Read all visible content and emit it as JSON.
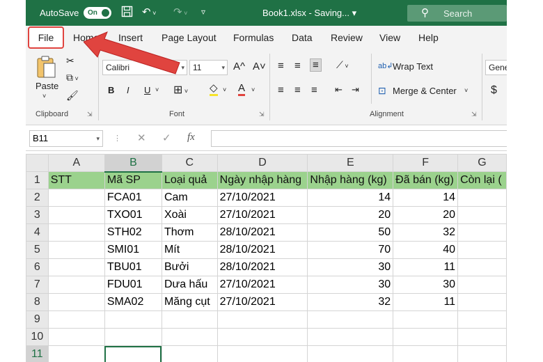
{
  "titlebar": {
    "autosave_label": "AutoSave",
    "autosave_state": "On",
    "save_icon": "save-icon",
    "undo_icon": "undo-icon",
    "redo_icon": "redo-icon",
    "customize_icon": "customize-qat-icon",
    "filename": "Book1.xlsx - Saving... ▾",
    "search_placeholder": "Search"
  },
  "tabs": [
    {
      "label": "File"
    },
    {
      "label": "Home"
    },
    {
      "label": "Insert"
    },
    {
      "label": "Page Layout"
    },
    {
      "label": "Formulas"
    },
    {
      "label": "Data"
    },
    {
      "label": "Review"
    },
    {
      "label": "View"
    },
    {
      "label": "Help"
    }
  ],
  "ribbon": {
    "clipboard": {
      "paste": "Paste",
      "group": "Clipboard"
    },
    "font": {
      "name": "Calibri",
      "size": "11",
      "grow": "A^",
      "shrink": "A˅",
      "bold": "B",
      "italic": "I",
      "underline": "U",
      "group": "Font"
    },
    "alignment": {
      "wrap": "Wrap Text",
      "merge": "Merge & Center",
      "group": "Alignment"
    },
    "number": {
      "format": "Gene",
      "currency": "$"
    }
  },
  "formula_bar": {
    "name_box": "B11",
    "cancel": "✕",
    "enter": "✓",
    "fx": "fx",
    "value": ""
  },
  "grid": {
    "columns": [
      "A",
      "B",
      "C",
      "D",
      "E",
      "F",
      "G"
    ],
    "rows": [
      {
        "n": "1",
        "cells": [
          "STT",
          "Mã SP",
          "Loại quả",
          "Ngày nhập hàng",
          "Nhập hàng (kg)",
          "Đã bán (kg)",
          "Còn lại ("
        ]
      },
      {
        "n": "2",
        "cells": [
          "",
          "FCA01",
          "Cam",
          "27/10/2021",
          "14",
          "14",
          ""
        ]
      },
      {
        "n": "3",
        "cells": [
          "",
          "TXO01",
          "Xoài",
          "27/10/2021",
          "20",
          "20",
          ""
        ]
      },
      {
        "n": "4",
        "cells": [
          "",
          "STH02",
          "Thơm",
          "28/10/2021",
          "50",
          "32",
          ""
        ]
      },
      {
        "n": "5",
        "cells": [
          "",
          "SMI01",
          "Mít",
          "28/10/2021",
          "70",
          "40",
          ""
        ]
      },
      {
        "n": "6",
        "cells": [
          "",
          "TBU01",
          "Bưởi",
          "28/10/2021",
          "30",
          "11",
          ""
        ]
      },
      {
        "n": "7",
        "cells": [
          "",
          "FDU01",
          "Dưa hấu",
          "27/10/2021",
          "30",
          "30",
          ""
        ]
      },
      {
        "n": "8",
        "cells": [
          "",
          "SMA02",
          "Măng cụt",
          "27/10/2021",
          "32",
          "11",
          ""
        ]
      },
      {
        "n": "9",
        "cells": [
          "",
          "",
          "",
          "",
          "",
          "",
          ""
        ]
      },
      {
        "n": "10",
        "cells": [
          "",
          "",
          "",
          "",
          "",
          "",
          ""
        ]
      },
      {
        "n": "11",
        "cells": [
          "",
          "",
          "",
          "",
          "",
          "",
          ""
        ]
      }
    ]
  },
  "colors": {
    "excel_green": "#1f7145",
    "header_fill": "#9bd28d",
    "highlight_red": "#e0443f"
  }
}
